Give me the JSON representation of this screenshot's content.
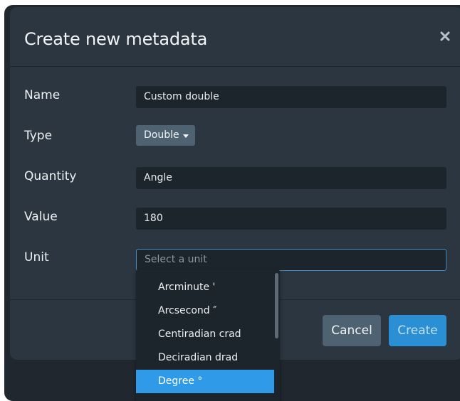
{
  "modal": {
    "title": "Create new metadata",
    "close_icon": "close-icon"
  },
  "form": {
    "name": {
      "label": "Name",
      "value": "Custom double"
    },
    "type": {
      "label": "Type",
      "value": "Double"
    },
    "quantity": {
      "label": "Quantity",
      "value": "Angle"
    },
    "value": {
      "label": "Value",
      "value": "180"
    },
    "unit": {
      "label": "Unit",
      "value": "",
      "placeholder": "Select a unit"
    }
  },
  "unit_options": {
    "items": [
      {
        "label": "Arcminute '"
      },
      {
        "label": "Arcsecond ″"
      },
      {
        "label": "Centiradian crad"
      },
      {
        "label": "Deciradian drad"
      },
      {
        "label": "Degree °"
      }
    ],
    "selected": "Degree °"
  },
  "footer": {
    "cancel_label": "Cancel",
    "create_label": "Create"
  },
  "colors": {
    "modal_bg": "#2b3640",
    "field_bg": "#1d252c",
    "accent": "#2a8fd4",
    "selected_item": "#2e9ae8",
    "secondary_button": "#4f6272"
  }
}
